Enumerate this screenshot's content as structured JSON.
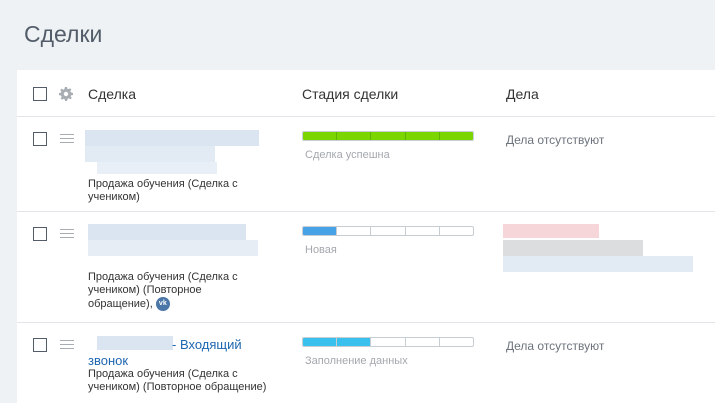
{
  "page": {
    "title": "Сделки"
  },
  "table": {
    "columns": {
      "deal": "Сделка",
      "stage": "Стадия сделки",
      "tasks": "Дела"
    }
  },
  "rows": [
    {
      "deal_name": "",
      "deal_subtitle": "Продажа обучения (Сделка с учеником)",
      "stage": {
        "label": "Сделка успешна",
        "color": "#7bd500",
        "filled_segments": 5,
        "total_segments": 5
      },
      "tasks": "Дела отсутствуют"
    },
    {
      "deal_name": "",
      "deal_subtitle": "Продажа обучения (Сделка с учеником) (Повторное обращение),",
      "source_icon": "vk-icon",
      "stage": {
        "label": "Новая",
        "color": "#47a3e6",
        "filled_segments": 1,
        "total_segments": 5
      },
      "tasks": ""
    },
    {
      "deal_name": "- Входящий звонок",
      "deal_subtitle": "Продажа обучения (Сделка с учеником) (Повторное обращение)",
      "stage": {
        "label": "Заполнение данных",
        "color": "#39c0ed",
        "filled_segments": 2,
        "total_segments": 5
      },
      "tasks": "Дела отсутствуют"
    }
  ],
  "colors": {
    "accent_link": "#2067b0",
    "background": "#eef2f4"
  }
}
